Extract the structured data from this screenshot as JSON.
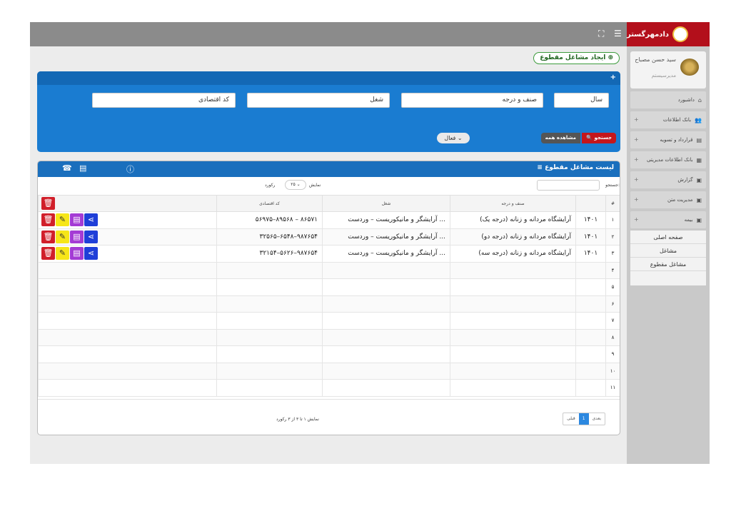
{
  "brand": {
    "name": "دادمهرگستر"
  },
  "user": {
    "name": "سید حسن مصباح",
    "role": "مدیرسیستم"
  },
  "sidebar": {
    "items": [
      {
        "label": "داشبورد",
        "icon": "home-icon",
        "expandable": false
      },
      {
        "label": "بانک اطلاعات",
        "icon": "users-icon",
        "expandable": true
      },
      {
        "label": "قرارداد و تسویه",
        "icon": "document-icon",
        "expandable": true
      },
      {
        "label": "بانک اطلاعات مدیریتی",
        "icon": "building-icon",
        "expandable": true
      },
      {
        "label": "گزارش",
        "icon": "calendar-icon",
        "expandable": true
      },
      {
        "label": "مدیریت متن",
        "icon": "calendar-icon",
        "expandable": true
      },
      {
        "label": "بیمه",
        "icon": "calendar-icon",
        "expandable": true
      }
    ],
    "submenu": [
      "صفحه اصلی",
      "مشاغل",
      "مشاغل مقطوع"
    ]
  },
  "page": {
    "title": "ایجاد مشاغل مقطوع"
  },
  "search": {
    "fields": {
      "year": "سال",
      "grade": "صنف و درجه",
      "job": "شغل",
      "econ_code": "کد اقتصادی"
    },
    "search_label": "جستجو",
    "view_all_label": "مشاهده همه",
    "status": "فعال"
  },
  "list": {
    "title": "لیست مشاغل مقطوع",
    "show_label": "نمایش",
    "page_size": "۲۵",
    "record_label": "رکورد",
    "search_label": "جستجو:",
    "headers": {
      "index": "#",
      "grade": "صنف و درجه",
      "job": "شغل",
      "econ_code": "کد اقتصادی"
    },
    "rows": [
      {
        "idx": "۱",
        "year": "۱۴۰۱",
        "grade": "آرایشگاه مردانه و زنانه (درجه یک)",
        "job": "آرایشگر و مانیکوریست – وردست ...",
        "code": "۵۶۹۷۵–۸۹۵۶۸ – ۸۶۵۷۱"
      },
      {
        "idx": "۲",
        "year": "۱۴۰۱",
        "grade": "آرایشگاه مردانه و زنانه (درجه دو)",
        "job": "آرایشگر و مانیکوریست – وردست ...",
        "code": "۳۲۵۶۵–۶۵۴۸–۹۸۷۶۵۴"
      },
      {
        "idx": "۳",
        "year": "۱۴۰۱",
        "grade": "آرایشگاه مردانه و زنانه (درجه سه)",
        "job": "آرایشگر و مانیکوریست – وردست ...",
        "code": "۳۲۱۵۴–۵۶۲۶–۹۸۷۶۵۴"
      },
      {
        "idx": "۴"
      },
      {
        "idx": "۵"
      },
      {
        "idx": "۶"
      },
      {
        "idx": "۷"
      },
      {
        "idx": "۸"
      },
      {
        "idx": "۹"
      },
      {
        "idx": "۱۰"
      },
      {
        "idx": "۱۱"
      }
    ],
    "footer_info": "نمایش ۱ تا ۳ از ۳ رکورد",
    "pager": {
      "prev": "قبلی",
      "current": "1",
      "next": "بعدی"
    }
  }
}
